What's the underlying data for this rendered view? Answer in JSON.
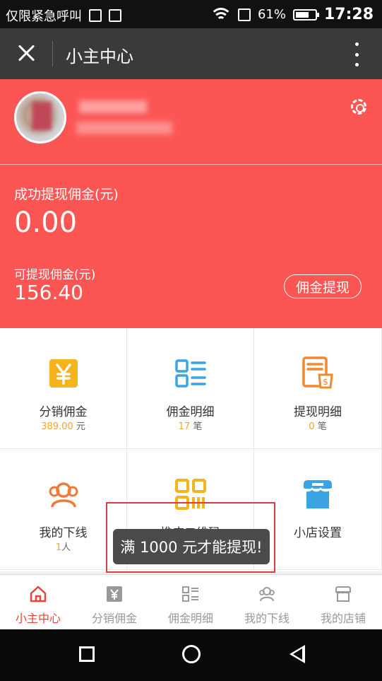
{
  "status_bar": {
    "carrier": "仅限紧急呼叫",
    "battery": "61%",
    "time": "17:28",
    "icons": [
      "image-icon",
      "upload-icon",
      "wifi-icon",
      "sim-icon",
      "battery-icon"
    ]
  },
  "header": {
    "title": "小主中心",
    "close_icon": "close-icon",
    "menu_icon": "more-vertical-icon"
  },
  "profile": {
    "settings_icon": "gear-icon"
  },
  "commission": {
    "success_label": "成功提现佣金(元)",
    "success_value": "0.00",
    "available_label": "可提现佣金(元)",
    "available_value": "156.40",
    "withdraw_button": "佣金提现"
  },
  "grid": [
    {
      "label": "分销佣金",
      "num": "389.00",
      "unit": "元",
      "icon": "yen-icon",
      "color": "#f5b31c"
    },
    {
      "label": "佣金明细",
      "num": "17",
      "unit": "笔",
      "icon": "list-icon",
      "color": "#3aa3e3"
    },
    {
      "label": "提现明细",
      "num": "0",
      "unit": "笔",
      "icon": "receipt-icon",
      "color": "#f08a2c"
    },
    {
      "label": "我的下线",
      "num": "1",
      "unit": "人",
      "icon": "users-icon",
      "color": "#f0793a"
    },
    {
      "label": "推广二维码",
      "num": "",
      "unit": "",
      "icon": "qrcode-icon",
      "color": "#f5b31c"
    },
    {
      "label": "小店设置",
      "num": "",
      "unit": "",
      "icon": "store-icon",
      "color": "#3aa3e3"
    }
  ],
  "toast": {
    "message": "满 1000 元才能提现!"
  },
  "tabs": [
    {
      "label": "小主中心",
      "icon": "home-icon",
      "active": true
    },
    {
      "label": "分销佣金",
      "icon": "yen-icon",
      "active": false
    },
    {
      "label": "佣金明细",
      "icon": "list-icon",
      "active": false
    },
    {
      "label": "我的下线",
      "icon": "users-icon",
      "active": false
    },
    {
      "label": "我的店铺",
      "icon": "store-icon",
      "active": false
    }
  ],
  "nav": {
    "back_icon": "square-icon",
    "home_icon": "circle-icon",
    "back_triangle_icon": "triangle-back-icon"
  },
  "colors": {
    "accent": "#fb5554",
    "titlebar": "#3a3a3a",
    "active_tab": "#e8443e"
  }
}
